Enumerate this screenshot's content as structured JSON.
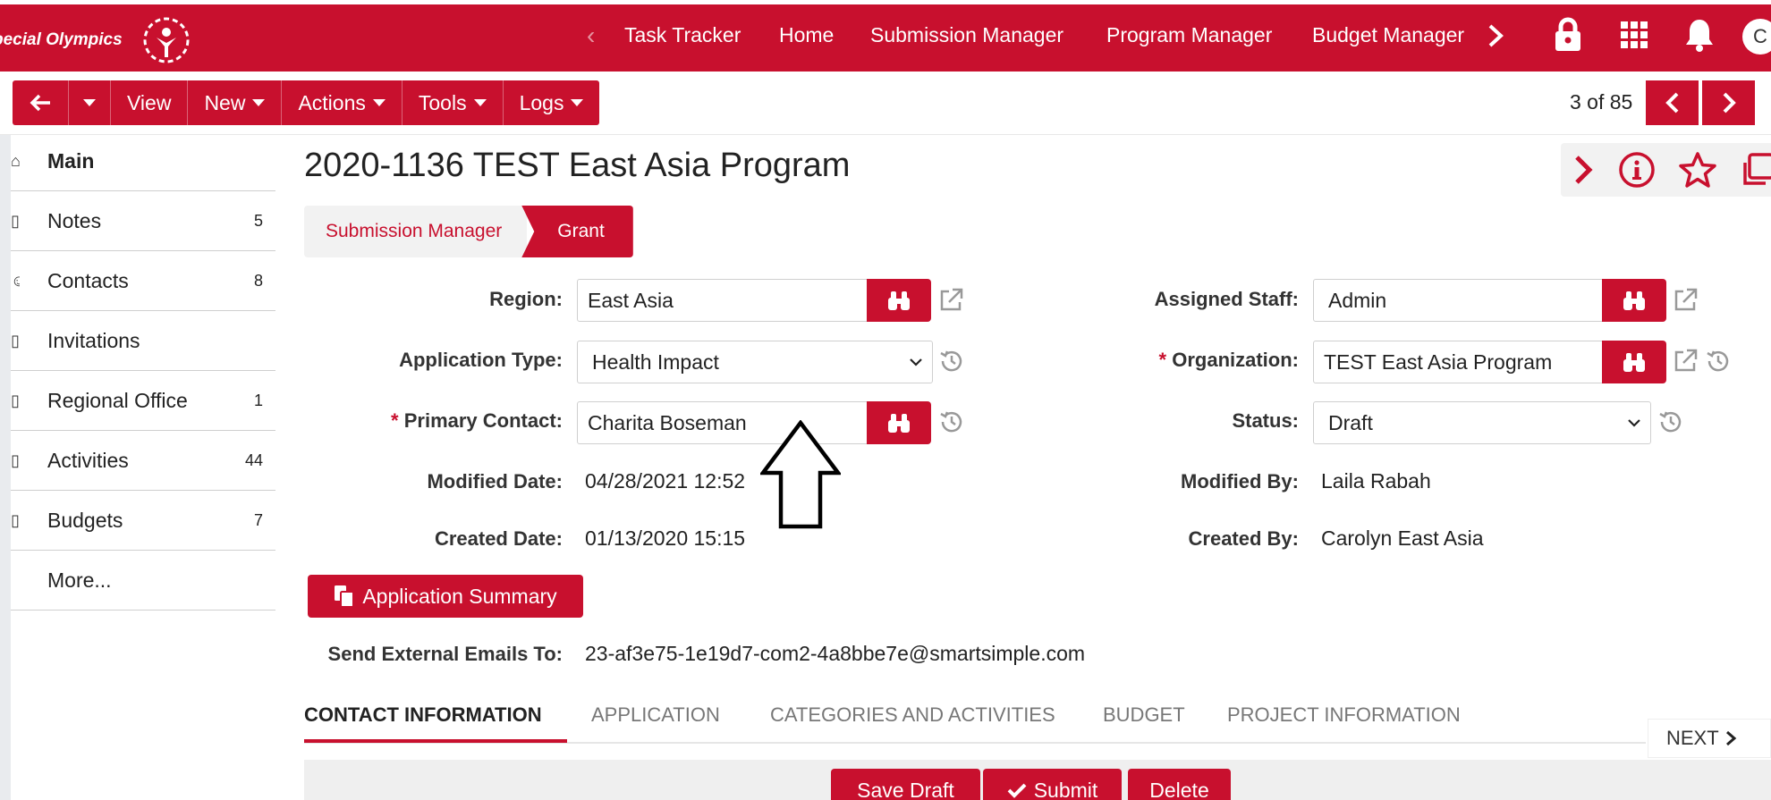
{
  "app": {
    "logo_text": "pecial Olympics",
    "avatar_initial": "C"
  },
  "topnav": {
    "items": [
      "Task Tracker",
      "Home",
      "Submission Manager",
      "Program Manager",
      "Budget Manager"
    ],
    "icons": [
      "chevron-left-icon",
      "chevron-right-icon",
      "lock-icon",
      "apps-grid-icon",
      "bell-icon"
    ]
  },
  "toolbar": {
    "view_label": "View",
    "new_label": "New",
    "actions_label": "Actions",
    "tools_label": "Tools",
    "logs_label": "Logs",
    "pager_text": "3 of 85"
  },
  "sidebar": {
    "items": [
      {
        "label": "Main",
        "count": ""
      },
      {
        "label": "Notes",
        "count": "5"
      },
      {
        "label": "Contacts",
        "count": "8"
      },
      {
        "label": "Invitations",
        "count": ""
      },
      {
        "label": "Regional Office",
        "count": "1"
      },
      {
        "label": "Activities",
        "count": "44"
      },
      {
        "label": "Budgets",
        "count": "7"
      },
      {
        "label": "More...",
        "count": ""
      }
    ]
  },
  "page": {
    "title": "2020-1136 TEST East Asia Program",
    "breadcrumb": [
      "Submission Manager",
      "Grant"
    ]
  },
  "form": {
    "region": {
      "label": "Region:",
      "value": "East Asia"
    },
    "application_type": {
      "label": "Application Type:",
      "value": "Health Impact"
    },
    "primary_contact": {
      "required": "*",
      "label": "Primary Contact:",
      "value": "Charita Boseman"
    },
    "modified_date": {
      "label": "Modified Date:",
      "value": "04/28/2021 12:52"
    },
    "created_date": {
      "label": "Created Date:",
      "value": "01/13/2020 15:15"
    },
    "assigned_staff": {
      "label": "Assigned Staff:",
      "value": "Admin"
    },
    "organization": {
      "required": "*",
      "label": "Organization:",
      "value": "TEST East Asia Program"
    },
    "status": {
      "label": "Status:",
      "value": "Draft"
    },
    "modified_by": {
      "label": "Modified By:",
      "value": "Laila Rabah"
    },
    "created_by": {
      "label": "Created By:",
      "value": "Carolyn East Asia"
    },
    "app_summary_label": "Application Summary",
    "send_emails": {
      "label": "Send External Emails To:",
      "value": "23-af3e75-1e19d7-com2-4a8bbe7e@smartsimple.com"
    }
  },
  "tabs": {
    "items": [
      "CONTACT INFORMATION",
      "APPLICATION",
      "CATEGORIES AND ACTIVITIES",
      "BUDGET",
      "PROJECT INFORMATION"
    ],
    "active": "CONTACT INFORMATION",
    "next_label": "NEXT"
  },
  "bottom": {
    "save_draft_label": "Save Draft",
    "submit_label": "Submit",
    "delete_label": "Delete"
  },
  "colors": {
    "brand_red": "#c8102e",
    "crumb_bg": "#f2f2f2",
    "page_bg": "#ffffff"
  }
}
